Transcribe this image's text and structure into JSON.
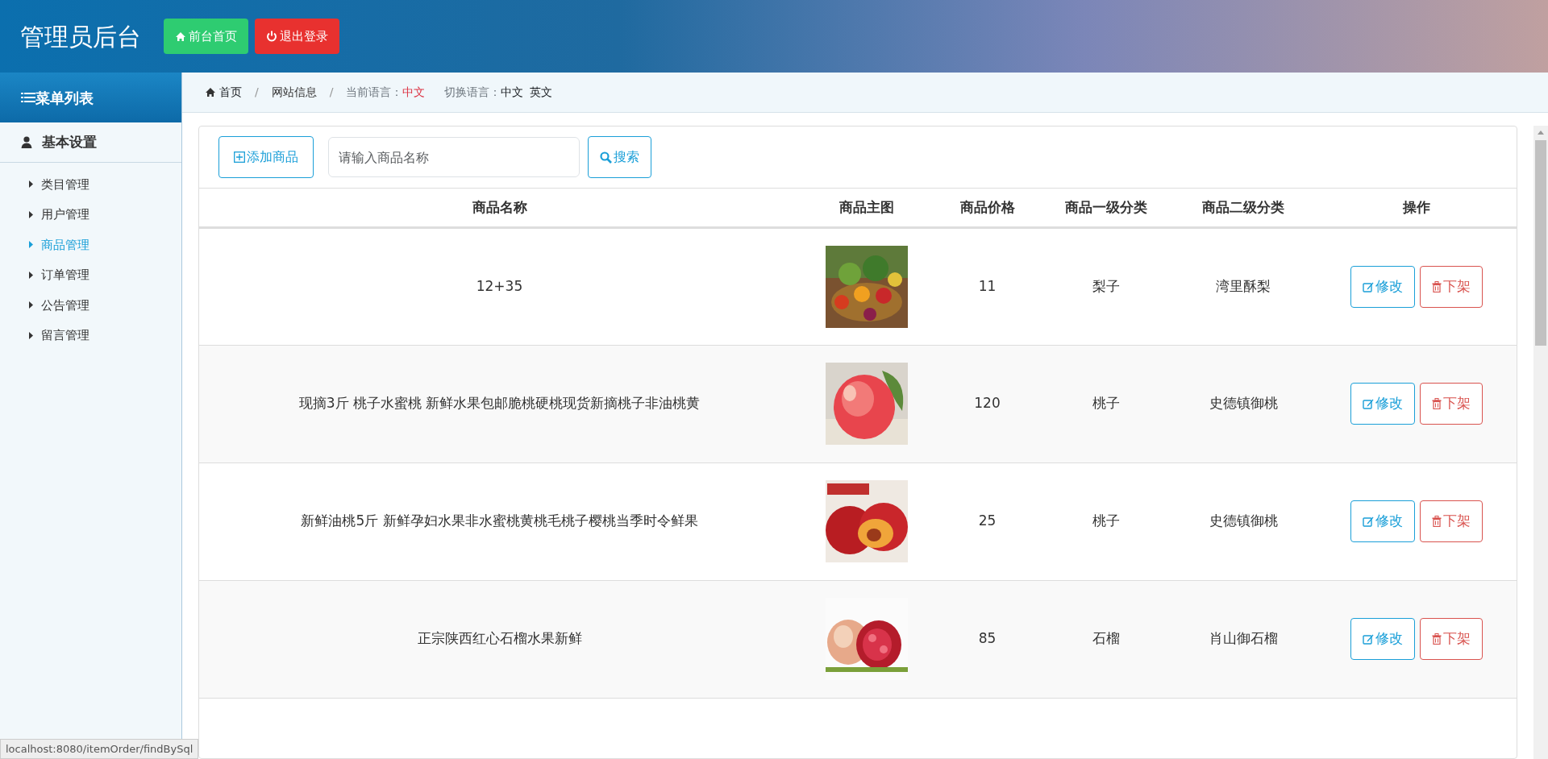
{
  "header": {
    "title": "管理员后台",
    "buttons": [
      {
        "label": "前台首页",
        "kind": "home"
      },
      {
        "label": "退出登录",
        "kind": "logout"
      }
    ]
  },
  "sidebar": {
    "title": "菜单列表",
    "group": "基本设置",
    "items": [
      {
        "label": "类目管理",
        "selected": false
      },
      {
        "label": "用户管理",
        "selected": false
      },
      {
        "label": "商品管理",
        "selected": true
      },
      {
        "label": "订单管理",
        "selected": false
      },
      {
        "label": "公告管理",
        "selected": false
      },
      {
        "label": "留言管理",
        "selected": false
      }
    ]
  },
  "breadcrumb": {
    "separator": "/",
    "home": "首页",
    "page": "网站信息",
    "language_label": "当前语言：",
    "language": "中文",
    "switch_label": "切换语言：",
    "switch_options": [
      "中文",
      "英文"
    ]
  },
  "toolbar": {
    "add_button": "添加商品",
    "search": {
      "placeholder": "请输入商品名称"
    },
    "search_button": "搜索"
  },
  "table": {
    "columns": [
      "商品名称",
      "商品主图",
      "商品价格",
      "商品一级分类",
      "商品二级分类",
      "操作"
    ],
    "rows": [
      {
        "name": "12+35",
        "price": "11",
        "category_1": "梨子",
        "category_2": "湾里酥梨",
        "actions": [
          "修改",
          "下架"
        ]
      },
      {
        "name": "现摘3斤 桃子水蜜桃 新鲜水果包邮脆桃硬桃现货新摘桃子非油桃黄",
        "price": "120",
        "category_1": "桃子",
        "category_2": "史德镇御桃",
        "actions": [
          "修改",
          "下架"
        ]
      },
      {
        "name": "新鲜油桃5斤 新鲜孕妇水果非水蜜桃黄桃毛桃子樱桃当季时令鲜果",
        "price": "25",
        "category_1": "桃子",
        "category_2": "史德镇御桃",
        "actions": [
          "修改",
          "下架"
        ]
      },
      {
        "name": "正宗陕西红心石榴水果新鲜",
        "price": "85",
        "category_1": "石榴",
        "category_2": "肖山御石榴",
        "actions": [
          "修改",
          "下架"
        ]
      }
    ]
  },
  "status_bar": "localhost:8080/itemOrder/findBySql"
}
